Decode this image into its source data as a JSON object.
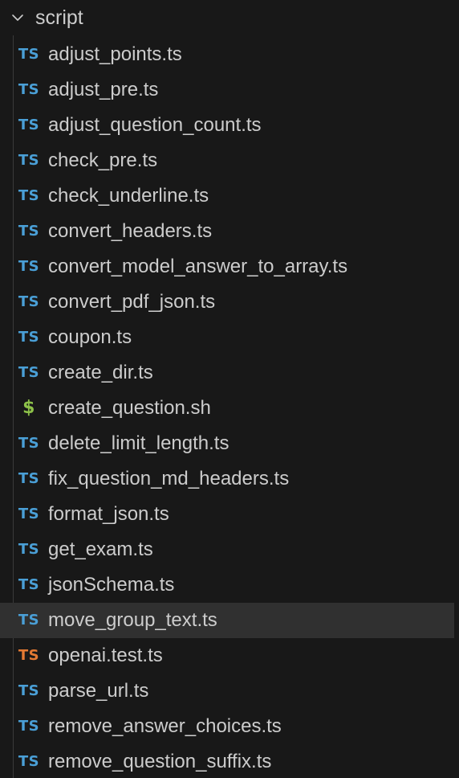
{
  "explorer": {
    "folder": {
      "name": "script",
      "expanded": true,
      "chevron_icon": "chevron-down-icon"
    },
    "selected_index": 16,
    "colors": {
      "background": "#181818",
      "selected_row": "#303030",
      "ts_icon": "#4a9fd6",
      "ts_test_icon": "#e37933",
      "shell_icon": "#8dc149",
      "text": "#cccccc"
    },
    "files": [
      {
        "icon_label": "TS",
        "icon": "typescript-icon",
        "kind": "ts",
        "name": "adjust_points.ts"
      },
      {
        "icon_label": "TS",
        "icon": "typescript-icon",
        "kind": "ts",
        "name": "adjust_pre.ts"
      },
      {
        "icon_label": "TS",
        "icon": "typescript-icon",
        "kind": "ts",
        "name": "adjust_question_count.ts"
      },
      {
        "icon_label": "TS",
        "icon": "typescript-icon",
        "kind": "ts",
        "name": "check_pre.ts"
      },
      {
        "icon_label": "TS",
        "icon": "typescript-icon",
        "kind": "ts",
        "name": "check_underline.ts"
      },
      {
        "icon_label": "TS",
        "icon": "typescript-icon",
        "kind": "ts",
        "name": "convert_headers.ts"
      },
      {
        "icon_label": "TS",
        "icon": "typescript-icon",
        "kind": "ts",
        "name": "convert_model_answer_to_array.ts"
      },
      {
        "icon_label": "TS",
        "icon": "typescript-icon",
        "kind": "ts",
        "name": "convert_pdf_json.ts"
      },
      {
        "icon_label": "TS",
        "icon": "typescript-icon",
        "kind": "ts",
        "name": "coupon.ts"
      },
      {
        "icon_label": "TS",
        "icon": "typescript-icon",
        "kind": "ts",
        "name": "create_dir.ts"
      },
      {
        "icon_label": "$",
        "icon": "shell-script-icon",
        "kind": "sh",
        "name": "create_question.sh"
      },
      {
        "icon_label": "TS",
        "icon": "typescript-icon",
        "kind": "ts",
        "name": "delete_limit_length.ts"
      },
      {
        "icon_label": "TS",
        "icon": "typescript-icon",
        "kind": "ts",
        "name": "fix_question_md_headers.ts"
      },
      {
        "icon_label": "TS",
        "icon": "typescript-icon",
        "kind": "ts",
        "name": "format_json.ts"
      },
      {
        "icon_label": "TS",
        "icon": "typescript-icon",
        "kind": "ts",
        "name": "get_exam.ts"
      },
      {
        "icon_label": "TS",
        "icon": "typescript-icon",
        "kind": "ts",
        "name": "jsonSchema.ts"
      },
      {
        "icon_label": "TS",
        "icon": "typescript-icon",
        "kind": "ts",
        "name": "move_group_text.ts"
      },
      {
        "icon_label": "TS",
        "icon": "typescript-test-icon",
        "kind": "ts-test",
        "name": "openai.test.ts"
      },
      {
        "icon_label": "TS",
        "icon": "typescript-icon",
        "kind": "ts",
        "name": "parse_url.ts"
      },
      {
        "icon_label": "TS",
        "icon": "typescript-icon",
        "kind": "ts",
        "name": "remove_answer_choices.ts"
      },
      {
        "icon_label": "TS",
        "icon": "typescript-icon",
        "kind": "ts",
        "name": "remove_question_suffix.ts"
      }
    ]
  }
}
